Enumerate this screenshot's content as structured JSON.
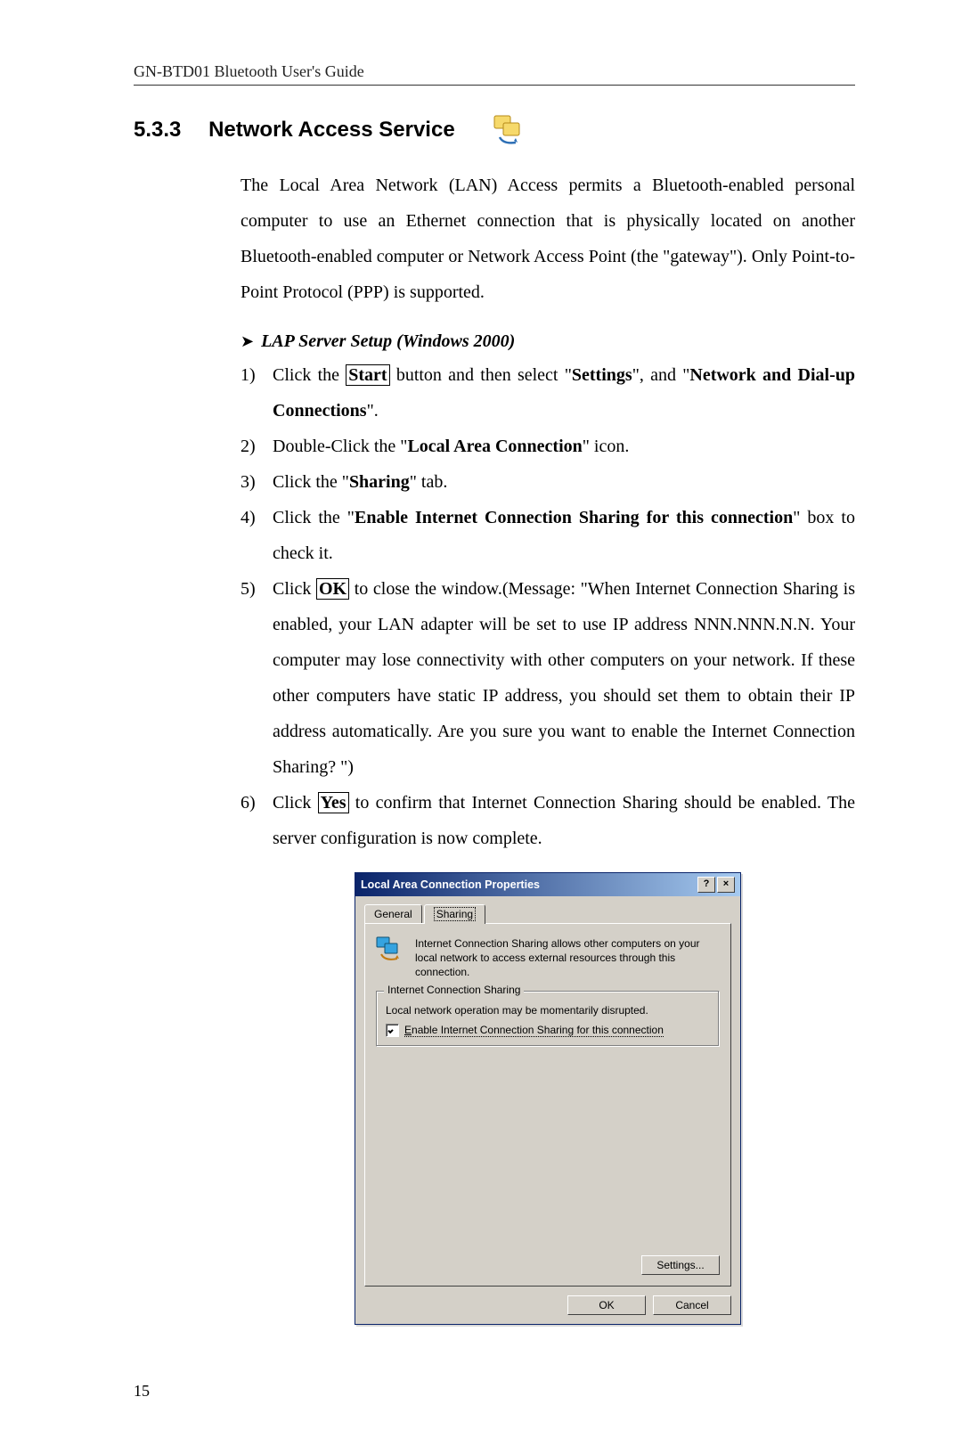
{
  "header": "GN-BTD01 Bluetooth User's Guide",
  "section": {
    "number": "5.3.3",
    "title": "Network Access Service"
  },
  "intro": "The Local Area Network (LAN) Access permits a Bluetooth-enabled personal computer to use an Ethernet connection that is physically located on another Bluetooth-enabled computer or Network Access Point (the \"gateway\"). Only Point-to-Point Protocol (PPP) is supported.",
  "subhead": "LAP Server Setup (Windows 2000)",
  "items": {
    "n1": "1)",
    "t1a": "Click the ",
    "t1_start": "Start",
    "t1b": " button and then select \"",
    "t1_settings": "Settings",
    "t1c": "\", and \"",
    "t1_net": "Network and Dial-up Connections",
    "t1d": "\".",
    "n2": "2)",
    "t2a": "Double-Click the \"",
    "t2_lac": "Local Area Connection",
    "t2b": "\" icon.",
    "n3": "3)",
    "t3a": "Click the \"",
    "t3_sh": "Sharing",
    "t3b": "\" tab.",
    "n4": "4)",
    "t4a": "Click the \"",
    "t4_en": "Enable Internet Connection Sharing for this connection",
    "t4b": "\" box to check it.",
    "n5": "5)",
    "t5a": "Click ",
    "t5_ok": "OK",
    "t5b": " to close the window.(Message: \"When Internet Connection Sharing is enabled, your LAN adapter will be set to use IP address NNN.NNN.N.N. Your computer may lose connectivity with other computers on your network. If these other computers have static IP address, you should set them to obtain their IP address automatically. Are you sure you want to enable the Internet Connection Sharing? \")",
    "n6": "6)",
    "t6a": "Click ",
    "t6_yes": "Yes",
    "t6b": " to confirm that Internet Connection Sharing should be enabled. The server configuration is now complete."
  },
  "dialog": {
    "title": "Local Area Connection Properties",
    "help_btn": "?",
    "close_btn": "×",
    "tab_general": "General",
    "tab_sharing": "Sharing",
    "info": "Internet Connection Sharing allows other computers on your local network to access external resources through this connection.",
    "group_label": "Internet Connection Sharing",
    "group_line": "Local network operation may be momentarily disrupted.",
    "checkbox_prefix": "E",
    "checkbox_rest": "nable Internet Connection Sharing for this connection",
    "settings_btn": "Settings...",
    "ok_btn": "OK",
    "cancel_btn": "Cancel"
  },
  "page_number": "15"
}
